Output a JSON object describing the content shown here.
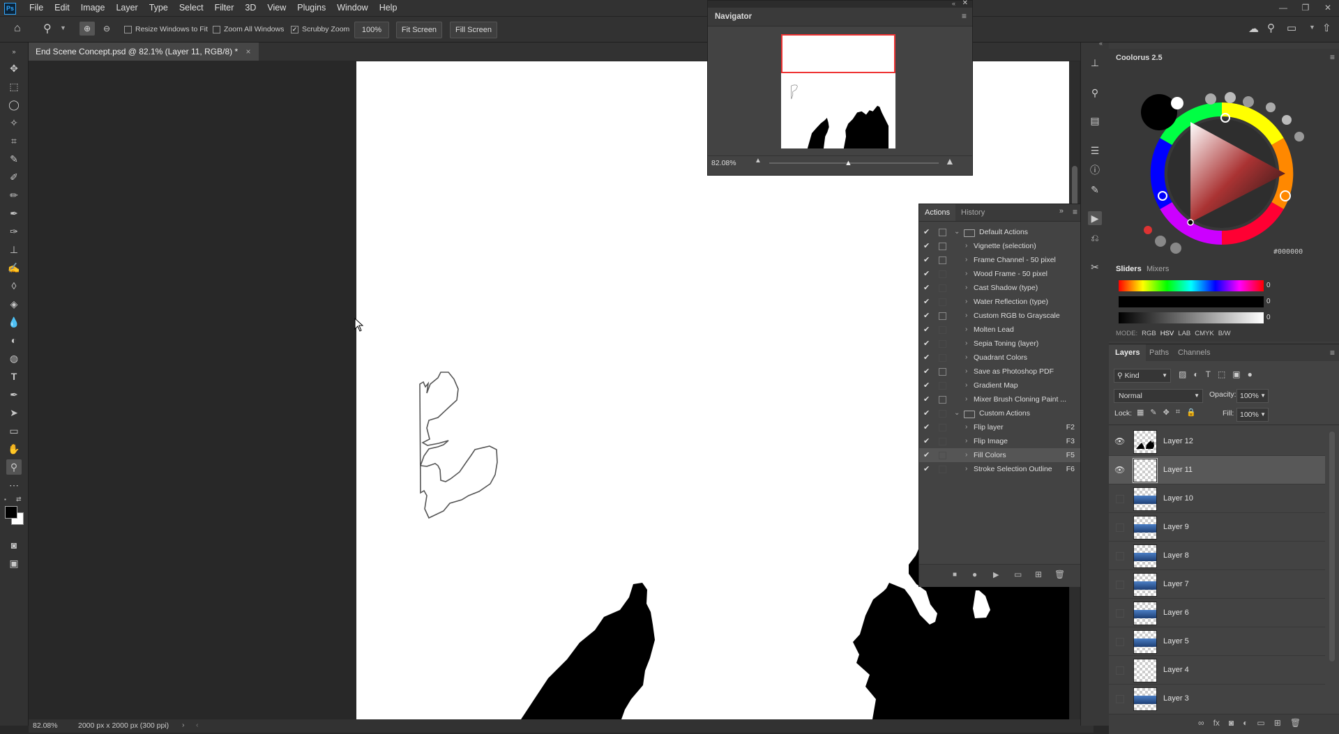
{
  "menubar": {
    "logo": "Ps",
    "menus": [
      "File",
      "Edit",
      "Image",
      "Layer",
      "Type",
      "Select",
      "Filter",
      "3D",
      "View",
      "Plugins",
      "Window",
      "Help"
    ]
  },
  "options": {
    "resize_windows": "Resize Windows to Fit",
    "zoom_all": "Zoom All Windows",
    "scrubby": "Scrubby Zoom",
    "zoom_value": "100%",
    "fit_screen": "Fit Screen",
    "fill_screen": "Fill Screen"
  },
  "document": {
    "tab_title": "End Scene Concept.psd @ 82.1% (Layer 11, RGB/8) *",
    "close": "×"
  },
  "status": {
    "zoom": "82.08%",
    "doc_info": "2000 px x 2000 px (300 ppi)"
  },
  "navigator": {
    "title": "Navigator",
    "zoom": "82.08%"
  },
  "actions": {
    "tabs": [
      "Actions",
      "History"
    ],
    "rows": [
      {
        "name": "Default Actions",
        "type": "set",
        "dialog": true,
        "expanded": true,
        "key": ""
      },
      {
        "name": "Vignette (selection)",
        "type": "action",
        "dialog": true,
        "key": ""
      },
      {
        "name": "Frame Channel - 50 pixel",
        "type": "action",
        "dialog": true,
        "key": ""
      },
      {
        "name": "Wood Frame - 50 pixel",
        "type": "action",
        "dialog": false,
        "key": ""
      },
      {
        "name": "Cast Shadow (type)",
        "type": "action",
        "dialog": false,
        "key": ""
      },
      {
        "name": "Water Reflection (type)",
        "type": "action",
        "dialog": false,
        "key": ""
      },
      {
        "name": "Custom RGB to Grayscale",
        "type": "action",
        "dialog": true,
        "key": ""
      },
      {
        "name": "Molten Lead",
        "type": "action",
        "dialog": false,
        "key": ""
      },
      {
        "name": "Sepia Toning (layer)",
        "type": "action",
        "dialog": false,
        "key": ""
      },
      {
        "name": "Quadrant Colors",
        "type": "action",
        "dialog": false,
        "key": ""
      },
      {
        "name": "Save as Photoshop PDF",
        "type": "action",
        "dialog": true,
        "key": ""
      },
      {
        "name": "Gradient Map",
        "type": "action",
        "dialog": false,
        "key": ""
      },
      {
        "name": "Mixer Brush Cloning Paint ...",
        "type": "action",
        "dialog": true,
        "key": ""
      },
      {
        "name": "Custom Actions",
        "type": "set",
        "dialog": false,
        "expanded": true,
        "key": ""
      },
      {
        "name": "Flip layer",
        "type": "action",
        "dialog": false,
        "key": "F2"
      },
      {
        "name": "Flip Image",
        "type": "action",
        "dialog": false,
        "key": "F3"
      },
      {
        "name": "Fill Colors",
        "type": "action",
        "dialog": false,
        "key": "F5",
        "selected": true
      },
      {
        "name": "Stroke Selection Outline",
        "type": "action",
        "dialog": false,
        "key": "F6"
      }
    ]
  },
  "coolorus": {
    "title": "Coolorus 2.5",
    "hex": "#000000",
    "slider_tabs": [
      "Sliders",
      "Mixers"
    ],
    "slider_values": [
      "0",
      "0",
      "0"
    ],
    "mode_label": "MODE:",
    "modes": [
      "RGB",
      "HSV",
      "LAB",
      "CMYK",
      "B/W"
    ]
  },
  "layers": {
    "tabs": [
      "Layers",
      "Paths",
      "Channels"
    ],
    "kind": "Kind",
    "blend": "Normal",
    "opacity_label": "Opacity:",
    "opacity": "100%",
    "lock_label": "Lock:",
    "fill_label": "Fill:",
    "fill": "100%",
    "items": [
      {
        "name": "Layer 12",
        "visible": true,
        "thumb": "silhouette"
      },
      {
        "name": "Layer 11",
        "visible": true,
        "thumb": "empty",
        "selected": true
      },
      {
        "name": "Layer 10",
        "visible": false,
        "thumb": "photo"
      },
      {
        "name": "Layer 9",
        "visible": false,
        "thumb": "photo"
      },
      {
        "name": "Layer 8",
        "visible": false,
        "thumb": "photo"
      },
      {
        "name": "Layer 7",
        "visible": false,
        "thumb": "photo"
      },
      {
        "name": "Layer 6",
        "visible": false,
        "thumb": "photo"
      },
      {
        "name": "Layer 5",
        "visible": false,
        "thumb": "photo"
      },
      {
        "name": "Layer 4",
        "visible": false,
        "thumb": "empty"
      },
      {
        "name": "Layer 3",
        "visible": false,
        "thumb": "photo"
      }
    ]
  }
}
